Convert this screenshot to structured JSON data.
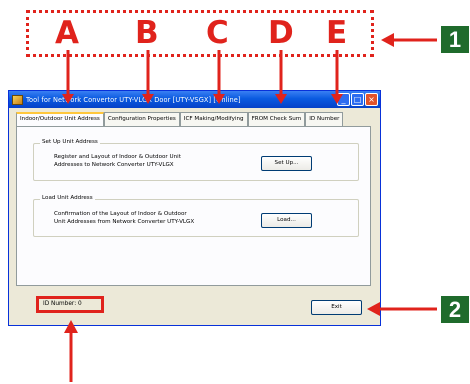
{
  "annotations": {
    "letters": [
      "A",
      "B",
      "C",
      "D",
      "E"
    ],
    "callout_1": "1",
    "callout_2": "2",
    "color": "#e0231c",
    "badge_color": "#1f6b2c"
  },
  "window": {
    "title": "Tool for Network Convertor UTY-VLGX Door [UTY-VSGX] [Online]",
    "buttons": {
      "minimize": "_",
      "maximize": "□",
      "close": "×"
    }
  },
  "tabs": [
    {
      "label": "Indoor/Outdoor Unit Address"
    },
    {
      "label": "Configuration Properties"
    },
    {
      "label": "ICF Making/Modifying"
    },
    {
      "label": "FROM Check Sum"
    },
    {
      "label": "ID Number"
    }
  ],
  "setup_group": {
    "title": "Set Up Unit Address",
    "line1": "Register and Layout of Indoor & Outdoor Unit",
    "line2": "Addresses to Network Converter UTY-VLGX",
    "button": "Set Up..."
  },
  "load_group": {
    "title": "Load Unit Address",
    "line1": "Confirmation of the Layout of Indoor & Outdoor",
    "line2": "Unit Addresses from Network Converter UTY-VLGX",
    "button": "Load..."
  },
  "status": {
    "id_number": "ID Number: 0"
  },
  "exit_button": "Exit"
}
